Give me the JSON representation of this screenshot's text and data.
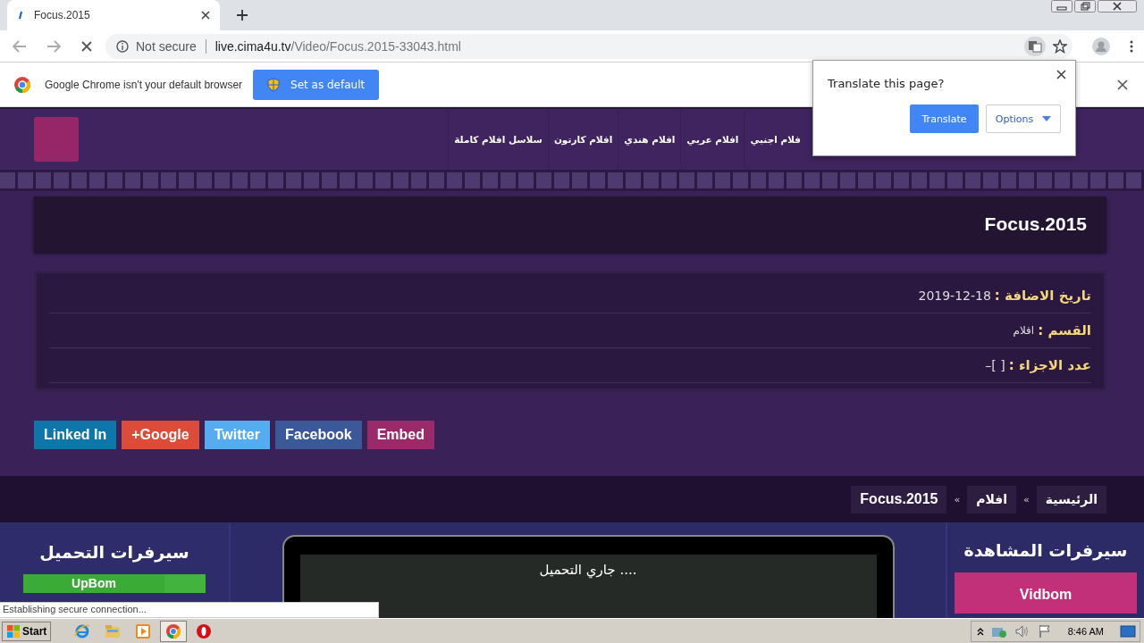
{
  "browser": {
    "tab": {
      "title": "Focus.2015"
    },
    "loading": true,
    "security": "Not secure",
    "url_host": "live.cima4u.tv",
    "url_path": "/Video/Focus.2015-33043.html"
  },
  "infobar": {
    "message": "Google Chrome isn't your default browser",
    "button": "Set as default"
  },
  "translate_popup": {
    "title": "Translate this page?",
    "translate_button": "Translate",
    "options_button": "Options"
  },
  "site": {
    "menu": [
      "فلام اجنبي",
      "افلام عربي",
      "افلام هندي",
      "افلام كارتون",
      "سلاسل افلام كاملة"
    ],
    "title": "Focus.2015",
    "details": [
      {
        "label": "تاريخ الاضافة :",
        "value": "2019-12-18"
      },
      {
        "label": "القسم :",
        "value": "افلام"
      },
      {
        "label": "عدد الاجزاء :",
        "value": "–[ ]"
      }
    ],
    "share": [
      {
        "label": "Embed",
        "color": "#9b2a6b"
      },
      {
        "label": "Facebook",
        "color": "#3b5998"
      },
      {
        "label": "Twitter",
        "color": "#55acee"
      },
      {
        "label": "+Google",
        "color": "#dd4b39"
      },
      {
        "label": "Linked In",
        "color": "#0e76a8"
      }
    ],
    "breadcrumb": [
      "الرئيسية",
      "افلام",
      "Focus.2015"
    ],
    "breadcrumb_separator": "«",
    "download": {
      "title": "سيرفرات التحميل",
      "servers": [
        "UpBom"
      ]
    },
    "player": {
      "message": "جاري التحميل ...."
    },
    "watch": {
      "title": "سيرفرات المشاهدة",
      "servers": [
        "Vidbom"
      ]
    }
  },
  "status": "Establishing secure connection...",
  "taskbar": {
    "start": "Start",
    "apps": [
      {
        "kind": "ie",
        "active": false
      },
      {
        "kind": "folder",
        "active": false
      },
      {
        "kind": "media",
        "active": false
      },
      {
        "kind": "chrome",
        "active": true
      },
      {
        "kind": "opera",
        "active": false
      }
    ],
    "clock": "8:46 AM"
  }
}
